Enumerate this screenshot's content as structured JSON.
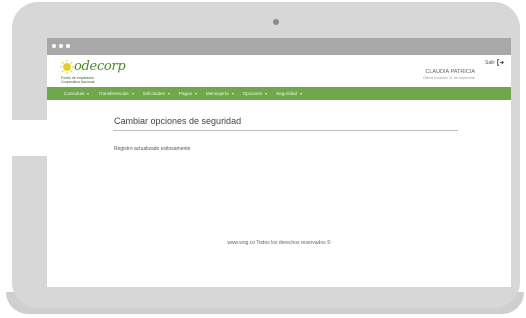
{
  "header": {
    "logo_name": "odecorp",
    "logo_tagline": "Fondo de empleados\nCooperativa Nacional",
    "user_name": "CLAUDIA PATRICIA",
    "last_login": "Última conexión 21 de noviembre",
    "logout_label": "Salir"
  },
  "nav": {
    "items": [
      {
        "label": "Consultas"
      },
      {
        "label": "Transferencias"
      },
      {
        "label": "Solicitudes"
      },
      {
        "label": "Pagos"
      },
      {
        "label": "Mensajería"
      },
      {
        "label": "Opciones"
      },
      {
        "label": "Seguridad"
      }
    ]
  },
  "main": {
    "title": "Cambiar opciones de seguridad",
    "status_message": "Registro actualizado exitosamente"
  },
  "footer": {
    "text": "www.wog.co Todos los derechos reservados ©"
  },
  "colors": {
    "nav_green": "#6fa84a",
    "logo_green": "#4a8a2a",
    "frame_gray": "#d7d7d7"
  }
}
